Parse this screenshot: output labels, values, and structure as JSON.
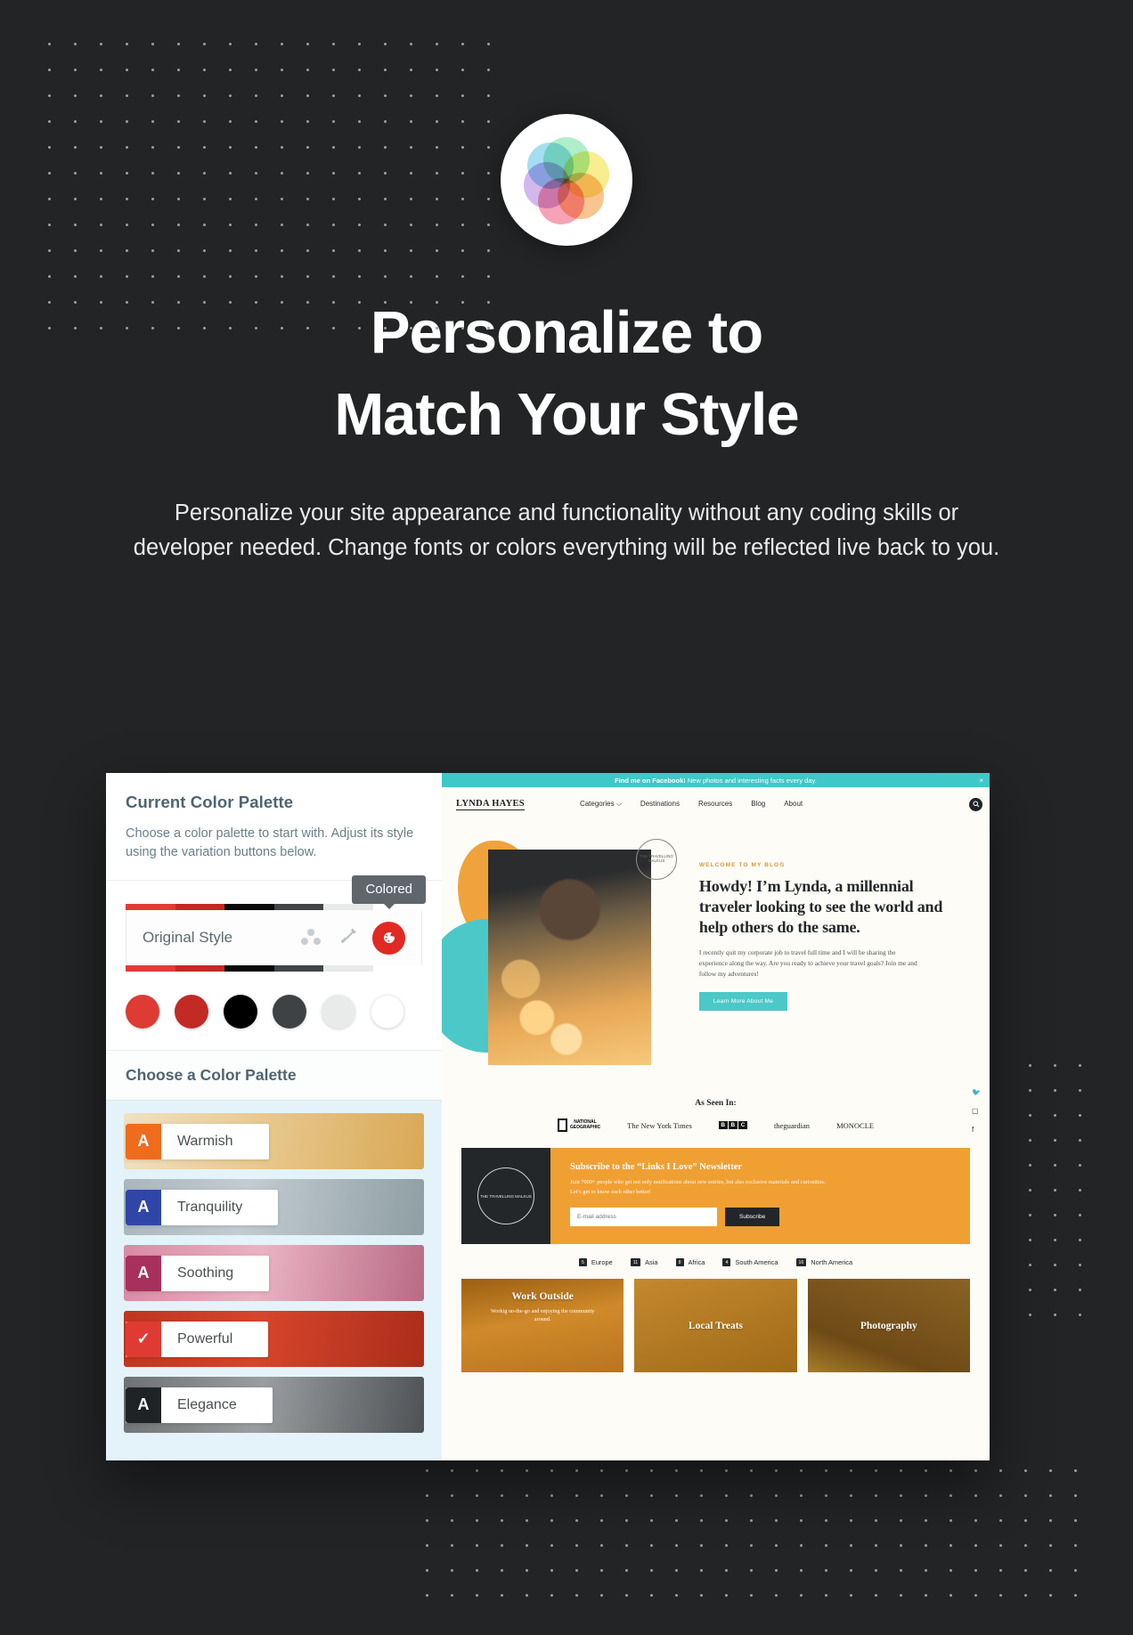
{
  "hero": {
    "logo_icon": "color-wheel-icon",
    "title_line1": "Personalize to",
    "title_line2": "Match Your Style",
    "subtitle": "Personalize your site appearance and functionality without any coding skills or developer needed. Change fonts or colors everything will be reflected live back to you."
  },
  "panel": {
    "title": "Current Color Palette",
    "description": "Choose a color palette to start with. Adjust its style using the variation buttons below.",
    "tooltip": "Colored",
    "current_style_label": "Original Style",
    "icons": [
      "palette-dots-icon",
      "brush-icon",
      "color-toggle-icon"
    ],
    "bar_colors": [
      "#e03c36",
      "#c22a25",
      "#0a0a0a",
      "#414547",
      "#e7eae9",
      "#ffffff"
    ],
    "swatches": [
      "#dd3b34",
      "#c22a25",
      "#000000",
      "#3f4244",
      "#e8ebea",
      "#ffffff"
    ],
    "sub_title": "Choose a Color Palette",
    "palettes": [
      {
        "name": "Warmish",
        "badge": "A",
        "badge_color": "#ef6c1d",
        "thumb": "linear-gradient(100deg,#f0e0c4,#e8c98f 45%,#d9a855)"
      },
      {
        "name": "Tranquility",
        "badge": "A",
        "badge_color": "#2f46a8",
        "thumb": "linear-gradient(100deg,#a9b6bd,#c3ccd0 40%,#8e9ea3)"
      },
      {
        "name": "Soothing",
        "badge": "A",
        "badge_color": "#a8305c",
        "thumb": "linear-gradient(100deg,#d98ba3,#e9b3c2 45%,#b96a85)"
      },
      {
        "name": "Powerful",
        "badge": "✓",
        "badge_color": "#df3b33",
        "thumb": "linear-gradient(100deg,#c0351f,#d6452c 45%,#ab2d19)"
      },
      {
        "name": "Elegance",
        "badge": "A",
        "badge_color": "#1f2326",
        "thumb": "linear-gradient(100deg,#6e7275,#9a9ea1 45%,#4e5255)"
      }
    ]
  },
  "preview": {
    "banner": {
      "bold": "Find me on Facebook!",
      "rest": "New photos and interesting facts every day.",
      "close": "×"
    },
    "logo": "LYNDA HAYES",
    "nav": [
      "Categories ⌵",
      "Destinations",
      "Resources",
      "Blog",
      "About"
    ],
    "search_icon": "search-icon",
    "stamp": "THE TRAVELLING MALKUS",
    "eyebrow": "WELCOME TO MY BLOG",
    "heading": "Howdy! I’m Lynda, a millennial traveler looking to see the world and help others do the same.",
    "paragraph": "I recently quit my corporate job to travel full time and I will be sharing the experience along the way. Are you ready to achieve your travel goals?  Join me and follow my adventures!",
    "cta": "Learn More About Me",
    "social": [
      "twitter-icon",
      "instagram-icon",
      "facebook-icon"
    ],
    "as_seen_title": "As Seen In:",
    "as_seen_logos": [
      {
        "type": "natgeo",
        "line1": "NATIONAL",
        "line2": "GEOGRAPHIC"
      },
      {
        "type": "text",
        "label": "The New York Times"
      },
      {
        "type": "bbc",
        "letters": [
          "B",
          "B",
          "C"
        ]
      },
      {
        "type": "text",
        "label": "theguardian"
      },
      {
        "type": "text",
        "label": "MONOCLE"
      }
    ],
    "newsletter": {
      "mark": "THE TRAVELLING MALKUS",
      "title": "Subscribe to the “Links I Love” Newsletter",
      "body": "Join 7000+ people who get not only notifications about new entries, but also exclusive materials and curiosities. Let’s get to know each other better!",
      "placeholder": "E-mail address",
      "button": "Subscribe"
    },
    "tags": [
      {
        "count": "5",
        "label": "Europe"
      },
      {
        "count": "11",
        "label": "Asia"
      },
      {
        "count": "8",
        "label": "Africa"
      },
      {
        "count": "4",
        "label": "South America"
      },
      {
        "count": "16",
        "label": "North America"
      }
    ],
    "cards": [
      {
        "title": "Work Outside",
        "sub": "Workig on-the-go and enjoying the community around."
      },
      {
        "title": "Local Treats",
        "sub": ""
      },
      {
        "title": "Photography",
        "sub": ""
      }
    ]
  },
  "colors": {
    "page_bg": "#222425",
    "accent_teal": "#4cc8c8",
    "accent_orange": "#f0a033",
    "accent_red": "#e02a23"
  }
}
